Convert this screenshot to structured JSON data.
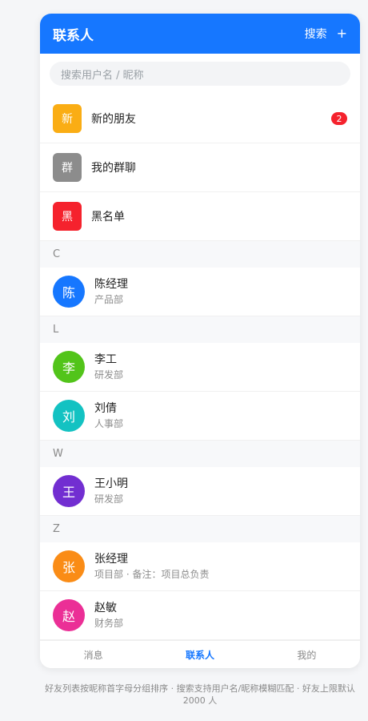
{
  "header": {
    "title": "联系人",
    "search_label": "搜索",
    "add_label": "+"
  },
  "search": {
    "placeholder": "搜索用户名 / 昵称"
  },
  "shortcuts": [
    {
      "label": "新的朋友",
      "icon_text": "新",
      "color": "#faad14",
      "badge": "2"
    },
    {
      "label": "我的群聊",
      "icon_text": "群",
      "color": "#8c8c8c"
    },
    {
      "label": "黑名单",
      "icon_text": "黑",
      "color": "#f5222d"
    }
  ],
  "groups": [
    {
      "letter": "C",
      "contacts": [
        {
          "avatar": "陈",
          "name": "陈经理",
          "dept": "产品部",
          "color": "#1677ff"
        }
      ]
    },
    {
      "letter": "L",
      "contacts": [
        {
          "avatar": "李",
          "name": "李工",
          "dept": "研发部",
          "color": "#52c41a"
        },
        {
          "avatar": "刘",
          "name": "刘倩",
          "dept": "人事部",
          "color": "#13c2c2"
        }
      ]
    },
    {
      "letter": "W",
      "contacts": [
        {
          "avatar": "王",
          "name": "王小明",
          "dept": "研发部",
          "color": "#722ed1"
        }
      ]
    },
    {
      "letter": "Z",
      "contacts": [
        {
          "avatar": "张",
          "name": "张经理",
          "dept": "项目部 · 备注：项目总负责",
          "color": "#fa8c16"
        },
        {
          "avatar": "赵",
          "name": "赵敏",
          "dept": "财务部",
          "color": "#eb2f96"
        }
      ]
    }
  ],
  "tabs": [
    {
      "label": "消息",
      "active": false
    },
    {
      "label": "联系人",
      "active": true
    },
    {
      "label": "我的",
      "active": false
    }
  ],
  "footnote": "好友列表按昵称首字母分组排序 · 搜索支持用户名/昵称模糊匹配 · 好友上限默认 2000 人"
}
